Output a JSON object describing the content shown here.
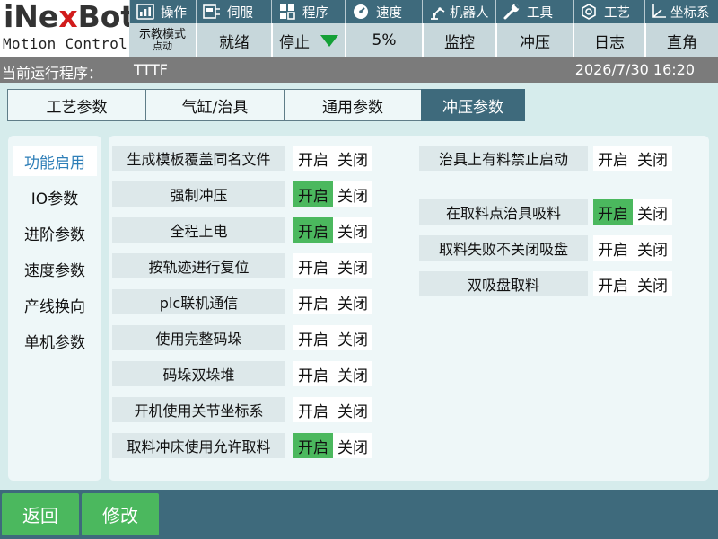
{
  "logo": {
    "brand_pre": "iNe",
    "brand_x": "x",
    "brand_post": "Bot",
    "subtitle": "Motion Control"
  },
  "menu": [
    {
      "label": "操作",
      "icon": "operate-icon"
    },
    {
      "label": "伺服",
      "icon": "servo-icon"
    },
    {
      "label": "程序",
      "icon": "program-icon"
    },
    {
      "label": "速度",
      "icon": "speed-icon"
    },
    {
      "label": "机器人",
      "icon": "robot-icon"
    },
    {
      "label": "工具",
      "icon": "wrench-icon"
    },
    {
      "label": "工艺",
      "icon": "process-icon"
    },
    {
      "label": "坐标系",
      "icon": "coordinate-icon"
    }
  ],
  "status": {
    "mode_line1": "示教模式",
    "mode_line2": "点动",
    "ready": "就绪",
    "stop": "停止",
    "speed": "5%",
    "monitor": "监控",
    "stamping": "冲压",
    "log": "日志",
    "coord": "直角"
  },
  "program": {
    "label": "当前运行程序：",
    "name": "TTTF",
    "datetime": "2026/7/30 16:20"
  },
  "tabs": [
    {
      "label": "工艺参数",
      "active": false
    },
    {
      "label": "气缸/治具",
      "active": false
    },
    {
      "label": "通用参数",
      "active": false
    },
    {
      "label": "冲压参数",
      "active": true
    }
  ],
  "sidenav": [
    {
      "label": "功能启用",
      "active": true
    },
    {
      "label": "IO参数",
      "active": false
    },
    {
      "label": "进阶参数",
      "active": false
    },
    {
      "label": "速度参数",
      "active": false
    },
    {
      "label": "产线换向",
      "active": false
    },
    {
      "label": "单机参数",
      "active": false
    }
  ],
  "toggle_labels": {
    "on": "开启",
    "off": "关闭"
  },
  "params_left": [
    {
      "label": "生成模板覆盖同名文件",
      "value": "off"
    },
    {
      "label": "强制冲压",
      "value": "on"
    },
    {
      "label": "全程上电",
      "value": "on"
    },
    {
      "label": "按轨迹进行复位",
      "value": "off"
    },
    {
      "label": "plc联机通信",
      "value": "off"
    },
    {
      "label": "使用完整码垛",
      "value": "off"
    },
    {
      "label": "码垛双垛堆",
      "value": "off"
    },
    {
      "label": "开机使用关节坐标系",
      "value": "off"
    },
    {
      "label": "取料冲床使用允许取料",
      "value": "on"
    }
  ],
  "params_right": [
    {
      "label": "治具上有料禁止启动",
      "value": "off"
    },
    {
      "label": "在取料点治具吸料",
      "value": "on"
    },
    {
      "label": "取料失败不关闭吸盘",
      "value": "off"
    },
    {
      "label": "双吸盘取料",
      "value": "off"
    }
  ],
  "bottom": {
    "back": "返回",
    "modify": "修改"
  },
  "colors": {
    "header": "#3e6a7c",
    "accent_on": "#4bb85e",
    "background": "#d6ecec",
    "panel": "#eef7f8"
  }
}
